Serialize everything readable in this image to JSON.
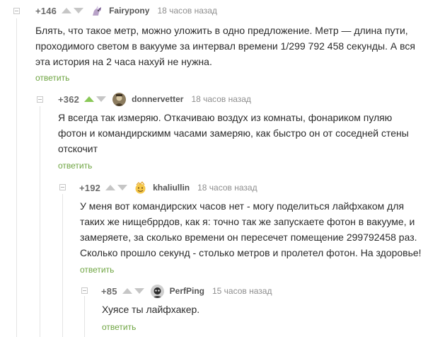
{
  "comments": [
    {
      "rating": "+146",
      "vote_up_active": false,
      "nick": "Fairypony",
      "time": "18 часов назад",
      "lines": [
        "Блять, что такое метр, можно уложить в одно предложение. Метр — длина пути,",
        "проходимого светом в вакууме за интервал времени 1/299 792 458 секунды. А вся",
        "эта история на 2 часа нахуй не нужна."
      ],
      "reply_label": "ответить"
    },
    {
      "rating": "+362",
      "vote_up_active": true,
      "nick": "donnervetter",
      "time": "18 часов назад",
      "lines": [
        "Я всегда так измеряю. Откачиваю воздух из комнаты, фонариком пуляю",
        "фотон и командирскимм часами замеряю, как быстро он от соседней стены",
        "отскочит"
      ],
      "reply_label": "ответить"
    },
    {
      "rating": "+192",
      "vote_up_active": false,
      "nick": "khaliullin",
      "time": "18 часов назад",
      "lines": [
        "У меня вот командирских часов нет - могу поделиться лайфхаком для",
        "таких же нищебррдов, как я: точно так же запускаете фотон в вакууме, и",
        "замеряете, за сколько времени он пересечет помещение 299792458 раз.",
        "Сколько прошло секунд - столько метров и пролетел фотон. На здоровье!"
      ],
      "reply_label": "ответить"
    },
    {
      "rating": "+85",
      "vote_up_active": false,
      "nick": "PerfPing",
      "time": "15 часов назад",
      "lines": [
        "Хуясе ты лайфхакер."
      ],
      "reply_label": "ответить"
    }
  ],
  "colors": {
    "vote_active": "#8ac858",
    "reply_link": "#6ea441"
  },
  "icons": {
    "vote_up": "triangle-up-icon",
    "vote_down": "triangle-down-icon",
    "collapse": "collapse-minus-icon"
  }
}
